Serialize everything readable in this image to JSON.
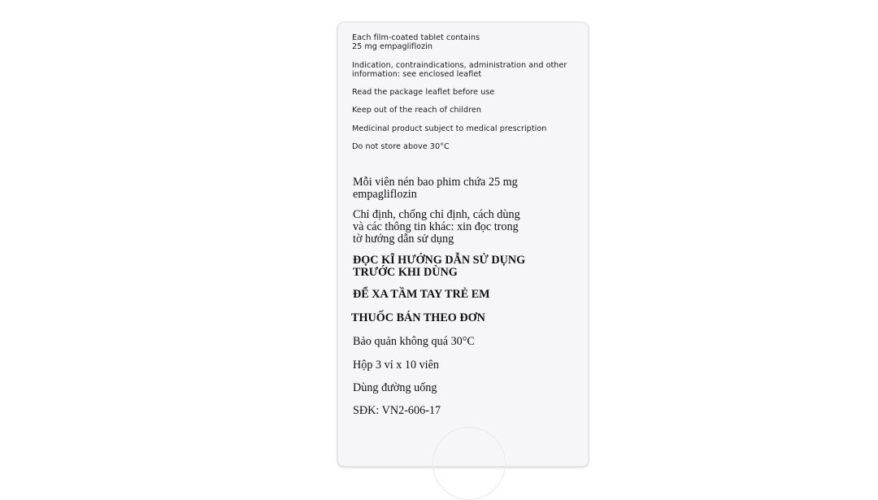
{
  "english": {
    "composition": "Each film-coated tablet contains\n25 mg empagliflozin",
    "indication": "Indication, contraindications, administration and other\ninformation: see enclosed leaflet",
    "read_leaflet": "Read the package leaflet before use",
    "children": "Keep out of the reach of children",
    "prescription": "Medicinal product subject to medical prescription",
    "storage": "Do not store above 30°C"
  },
  "vietnamese": {
    "composition": "Mỗi viên nén bao phim chứa 25 mg\nempagliflozin",
    "indication": "Chỉ định, chống chỉ định, cách dùng\nvà các thông tin khác: xin đọc trong\ntờ hướng dẫn sử dụng",
    "read_leaflet": "ĐỌC KĨ HƯỚNG DẪN SỬ DỤNG\nTRƯỚC KHI DÙNG",
    "children": "ĐỂ XA TẦM TAY TRẺ EM",
    "prescription": "THUỐC BÁN THEO ĐƠN",
    "storage": "Bảo quản không quá 30°C",
    "pack": "Hộp 3 vỉ x 10 viên",
    "route": "Dùng đường uống",
    "registration": "SĐK: VN2-606-17"
  }
}
